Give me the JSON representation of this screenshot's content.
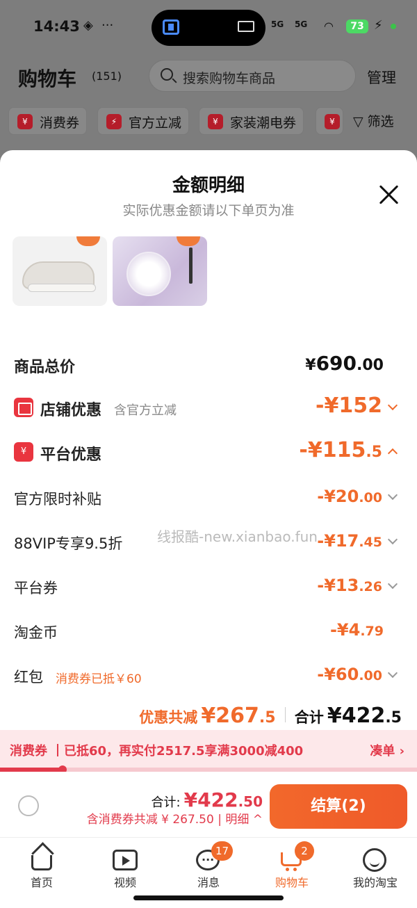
{
  "status_bar": {
    "time": "14:43",
    "signal1": "5G",
    "signal2": "5G",
    "battery": "73"
  },
  "header": {
    "title": "购物车",
    "count": "(151)",
    "search_placeholder": "搜索购物车商品",
    "manage": "管理"
  },
  "filter_chips": [
    {
      "label": "消费券"
    },
    {
      "label": "官方立减"
    },
    {
      "label": "家装潮电券"
    }
  ],
  "filter_label": "筛选",
  "sheet": {
    "title": "金额明细",
    "subtitle": "实际优惠金额请以下单页为准",
    "total_label": "商品总价",
    "total_sym": "¥",
    "total_int": "690",
    "total_dec": ".00",
    "store": {
      "label": "店铺优惠",
      "note": "含官方立减",
      "amount": "-¥152"
    },
    "platform": {
      "label": "平台优惠",
      "amount_int": "-¥115",
      "amount_dec": ".5"
    },
    "items": [
      {
        "label": "官方限时补贴",
        "amount_int": "-¥20",
        "amount_dec": ".00"
      },
      {
        "label": "88VIP专享9.5折",
        "amount_int": "-¥17",
        "amount_dec": ".45"
      },
      {
        "label": "平台券",
        "amount_int": "-¥13",
        "amount_dec": ".26"
      },
      {
        "label": "淘金币",
        "amount_int": "-¥4",
        "amount_dec": ".79"
      },
      {
        "label": "红包",
        "note": "消费券已抵￥60",
        "amount_int": "-¥60",
        "amount_dec": ".00"
      }
    ],
    "watermark": "线报酷-new.xianbao.fun",
    "summary": {
      "discount_label": "优惠共减",
      "discount_int": "¥267",
      "discount_dec": ".5",
      "total_label": "合计",
      "total_int": "¥422",
      "total_dec": ".5"
    }
  },
  "coupon_banner": {
    "tag": "消费券",
    "text": "已抵60，再实付2517.5享满3000减400",
    "action": "凑单 ›",
    "progress": 0.15
  },
  "bottom": {
    "total_label": "合计:",
    "total_int": "¥422",
    "total_dec": ".50",
    "savings": "含消费券共减 ¥ 267.50 | 明细 ^",
    "checkout": "结算(2)"
  },
  "tabs": [
    {
      "label": "首页",
      "icon": "home-icon"
    },
    {
      "label": "视频",
      "icon": "video-icon"
    },
    {
      "label": "消息",
      "icon": "message-icon",
      "badge": "17"
    },
    {
      "label": "购物车",
      "icon": "cart-icon",
      "badge": "2"
    },
    {
      "label": "我的淘宝",
      "icon": "profile-icon"
    }
  ],
  "colors": {
    "accent": "#f06a2b",
    "red": "#e23a4b"
  }
}
